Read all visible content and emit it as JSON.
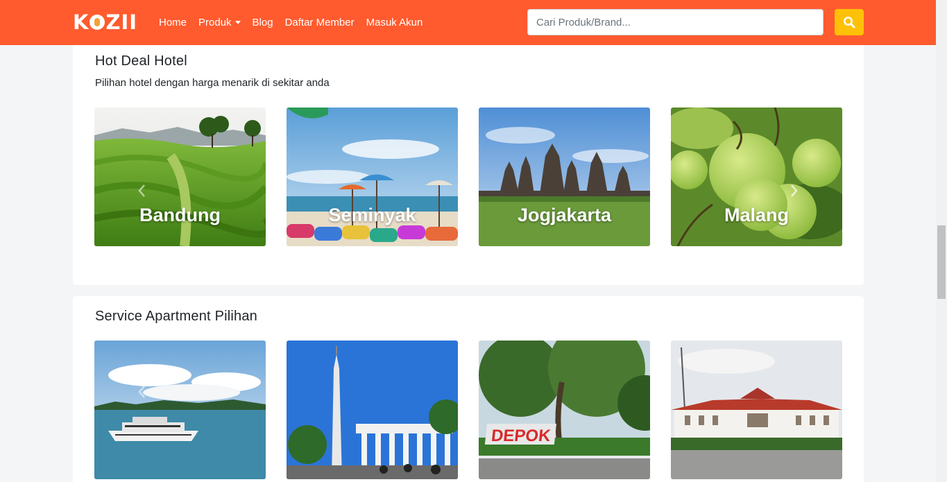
{
  "navbar": {
    "logo": "KOZII",
    "links": [
      "Home",
      "Produk",
      "Blog",
      "Daftar Member",
      "Masuk Akun"
    ],
    "search_placeholder": "Cari Produk/Brand...",
    "search_icon": "search-icon",
    "colors": {
      "navbar": "#ff5b2e",
      "search_button": "#ffc107"
    }
  },
  "hot_deal": {
    "title": "Hot Deal Hotel",
    "subtitle": "Pilihan hotel dengan harga menarik di sekitar anda",
    "cards": [
      {
        "label": "Bandung"
      },
      {
        "label": "Seminyak"
      },
      {
        "label": "Jogjakarta"
      },
      {
        "label": "Malang"
      }
    ],
    "prev_icon": "chevron-left-icon",
    "next_icon": "chevron-right-icon"
  },
  "service_apartment": {
    "title": "Service Apartment Pilihan",
    "cards": [
      {
        "name": "ferry-boat-photo"
      },
      {
        "name": "city-monument-photo"
      },
      {
        "name": "depok-sign-photo",
        "sign_text": "DEPOK"
      },
      {
        "name": "city-hall-photo"
      }
    ]
  }
}
